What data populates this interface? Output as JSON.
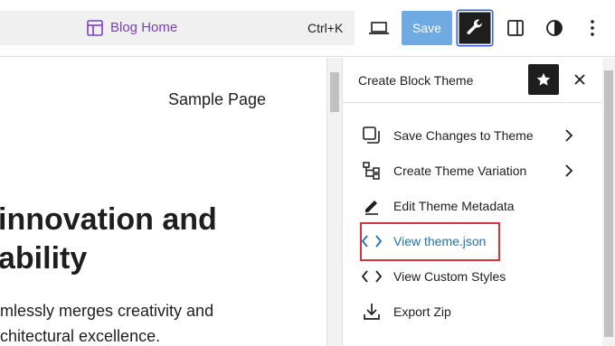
{
  "topbar": {
    "document_title": "Blog Home",
    "shortcut": "Ctrl+K",
    "save_label": "Save"
  },
  "canvas": {
    "nav_link": "Sample Page",
    "heading_line1": "innovation and",
    "heading_line2": "ability",
    "paragraph_line1": "mlessly merges creativity and",
    "paragraph_line2": "chitectural excellence."
  },
  "panel": {
    "title": "Create Block Theme",
    "items": [
      {
        "label": "Save Changes to Theme",
        "icon": "save-icon",
        "has_chevron": true
      },
      {
        "label": "Create Theme Variation",
        "icon": "variation-icon",
        "has_chevron": true
      },
      {
        "label": "Edit Theme Metadata",
        "icon": "pencil-icon",
        "has_chevron": false
      },
      {
        "label": "View theme.json",
        "icon": "code-icon",
        "has_chevron": false,
        "active": true
      },
      {
        "label": "View Custom Styles",
        "icon": "code-icon",
        "has_chevron": false
      },
      {
        "label": "Export Zip",
        "icon": "download-icon",
        "has_chevron": false
      }
    ]
  },
  "colors": {
    "accent": "#3858e9",
    "save_button": "#3f8fd6",
    "highlight_border": "#d63638",
    "active_link": "#2271b1",
    "template_title": "#7b3fc4"
  }
}
